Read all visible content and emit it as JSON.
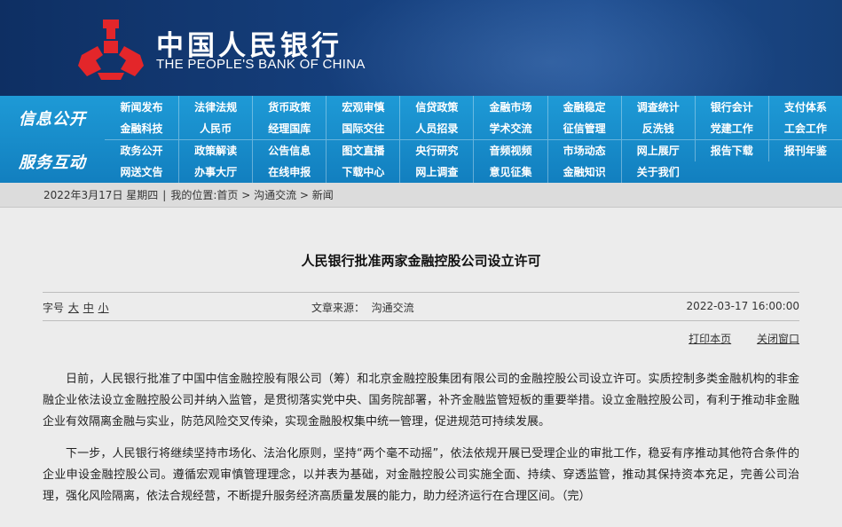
{
  "banner": {
    "title_cn": "中国人民银行",
    "title_en": "THE PEOPLE'S BANK OF CHINA",
    "logo_color": "#e3262a"
  },
  "nav": {
    "section1_label": "信息公开",
    "section2_label": "服务互动",
    "rows": [
      [
        "新闻发布",
        "法律法规",
        "货币政策",
        "宏观审慎",
        "信贷政策",
        "金融市场",
        "金融稳定",
        "调查统计",
        "银行会计",
        "支付体系"
      ],
      [
        "金融科技",
        "人民币",
        "经理国库",
        "国际交往",
        "人员招录",
        "学术交流",
        "征信管理",
        "反洗钱",
        "党建工作",
        "工会工作"
      ],
      [
        "政务公开",
        "政策解读",
        "公告信息",
        "图文直播",
        "央行研究",
        "音频视频",
        "市场动态",
        "网上展厅",
        "报告下载",
        "报刊年鉴"
      ],
      [
        "网送文告",
        "办事大厅",
        "在线申报",
        "下载中心",
        "网上调查",
        "意见征集",
        "金融知识",
        "关于我们"
      ]
    ]
  },
  "status": {
    "date": "2022年3月17日 星期四",
    "sep": "|",
    "location_label": "我的位置:",
    "crumb_home": "首页",
    "crumb_arrow": " > ",
    "crumb_2": "沟通交流",
    "crumb_3": "新闻"
  },
  "article": {
    "title": "人民银行批准两家金融控股公司设立许可",
    "font_label": "字号",
    "font_large": "大",
    "font_medium": "中",
    "font_small": "小",
    "source": "文章来源：  沟通交流",
    "datetime": "2022-03-17 16:00:00",
    "print": "打印本页",
    "close": "关闭窗口",
    "paragraphs": [
      "日前，人民银行批准了中国中信金融控股有限公司（筹）和北京金融控股集团有限公司的金融控股公司设立许可。实质控制多类金融机构的非金融企业依法设立金融控股公司并纳入监管，是贯彻落实党中央、国务院部署，补齐金融监管短板的重要举措。设立金融控股公司，有利于推动非金融企业有效隔离金融与实业，防范风险交叉传染，实现金融股权集中统一管理，促进规范可持续发展。",
      "下一步，人民银行将继续坚持市场化、法治化原则，坚持“两个毫不动摇”，依法依规开展已受理企业的审批工作，稳妥有序推动其他符合条件的企业申设金融控股公司。遵循宏观审慎管理理念，以并表为基础，对金融控股公司实施全面、持续、穿透监管，推动其保持资本充足，完善公司治理，强化风险隔离，依法合规经营，不断提升服务经济高质量发展的能力，助力经济运行在合理区间。（完）"
    ]
  }
}
